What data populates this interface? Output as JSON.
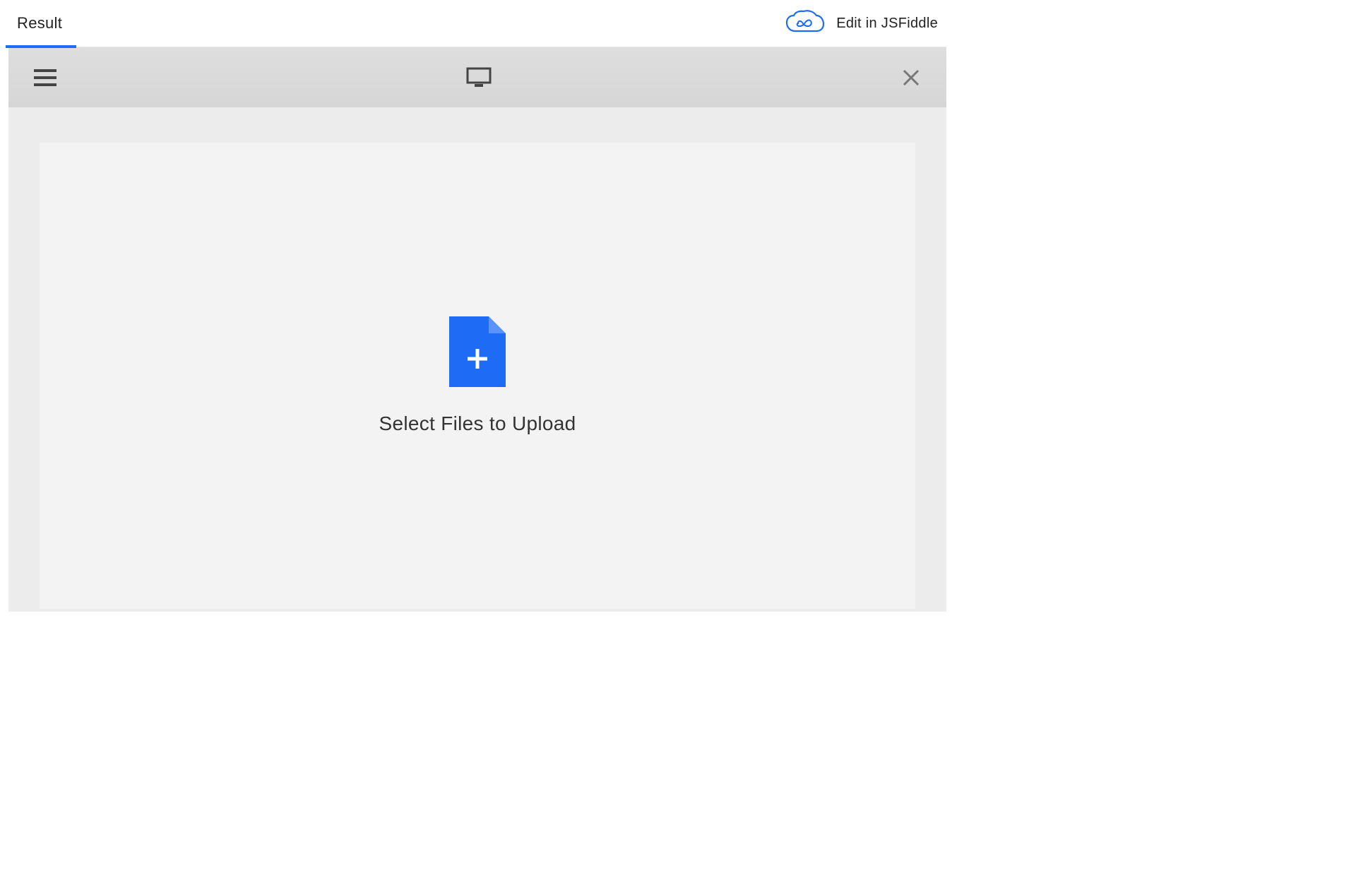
{
  "topbar": {
    "tab_label": "Result",
    "edit_link_label": "Edit in JSFiddle"
  },
  "toolbar": {
    "menu_icon": "hamburger-icon",
    "device_icon": "monitor-icon",
    "close_icon": "close-icon"
  },
  "upload": {
    "prompt_text": "Select Files to Upload",
    "icon": "file-plus-icon"
  },
  "colors": {
    "accent": "#1e6bf6",
    "file_blue": "#1e6bf6",
    "toolbar_bg": "#dadada",
    "panel_bg": "#f3f3f3"
  }
}
